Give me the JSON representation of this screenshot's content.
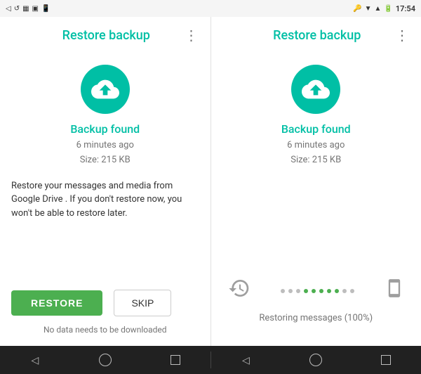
{
  "statusBar": {
    "leftIcons": [
      "◁",
      "↺",
      "📷",
      "▦",
      "📱"
    ],
    "time": "17:54",
    "rightIcons": [
      "🔑",
      "▼",
      "📶",
      "🔋"
    ]
  },
  "screen1": {
    "title": "Restore backup",
    "menuLabel": "⋮",
    "cloudIconAlt": "upload-cloud-icon",
    "backupFoundLabel": "Backup found",
    "timeAgo": "6 minutes ago",
    "size": "Size: 215 KB",
    "description": "Restore your messages and media from Google Drive . If you don't restore now, you won't be able to restore later.",
    "restoreButtonLabel": "RESTORE",
    "skipButtonLabel": "SKIP",
    "noDownloadText": "No data needs to be downloaded"
  },
  "screen2": {
    "title": "Restore backup",
    "menuLabel": "⋮",
    "cloudIconAlt": "upload-cloud-icon",
    "backupFoundLabel": "Backup found",
    "timeAgo": "6 minutes ago",
    "size": "Size: 215 KB",
    "progressDots": [
      false,
      false,
      false,
      true,
      true,
      true,
      true,
      true,
      false,
      false
    ],
    "restoringText": "Restoring messages (100%)"
  },
  "navBar": {
    "backLabel": "◁",
    "homeLabel": "○",
    "recentLabel": "□"
  }
}
